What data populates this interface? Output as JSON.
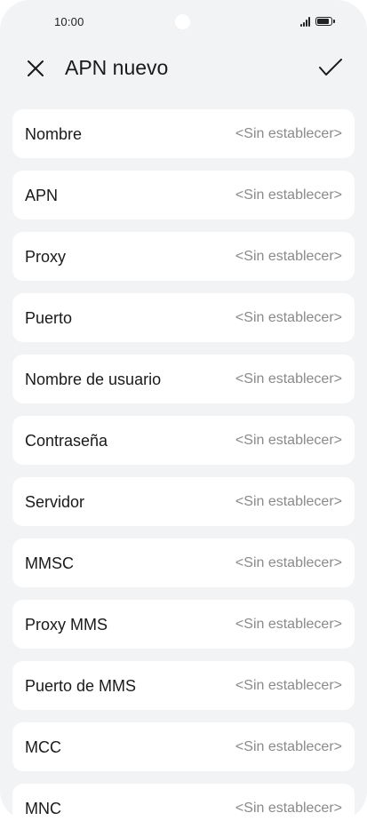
{
  "status_bar": {
    "time": "10:00"
  },
  "header": {
    "title": "APN nuevo",
    "close_icon": "close-icon",
    "confirm_icon": "check-icon"
  },
  "fields": [
    {
      "label": "Nombre",
      "value": "<Sin establecer>"
    },
    {
      "label": "APN",
      "value": "<Sin establecer>"
    },
    {
      "label": "Proxy",
      "value": "<Sin establecer>"
    },
    {
      "label": "Puerto",
      "value": "<Sin establecer>"
    },
    {
      "label": "Nombre de usuario",
      "value": "<Sin establecer>"
    },
    {
      "label": "Contraseña",
      "value": "<Sin establecer>"
    },
    {
      "label": "Servidor",
      "value": "<Sin establecer>"
    },
    {
      "label": "MMSC",
      "value": "<Sin establecer>"
    },
    {
      "label": "Proxy MMS",
      "value": "<Sin establecer>"
    },
    {
      "label": "Puerto de MMS",
      "value": "<Sin establecer>"
    },
    {
      "label": "MCC",
      "value": "<Sin establecer>"
    },
    {
      "label": "MNC",
      "value": "<Sin establecer>"
    }
  ]
}
